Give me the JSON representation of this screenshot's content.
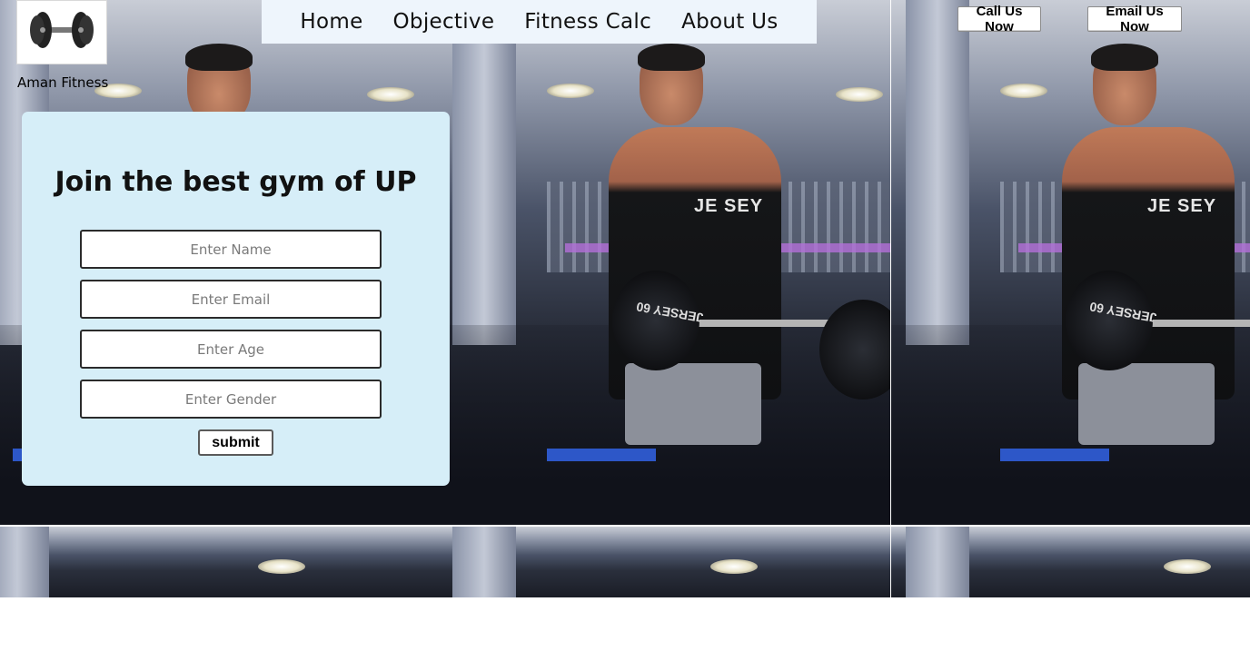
{
  "brand": {
    "name": "Aman Fitness",
    "logo_icon": "dumbbell-icon"
  },
  "nav": {
    "items": [
      {
        "label": "Home"
      },
      {
        "label": "Objective"
      },
      {
        "label": "Fitness Calc"
      },
      {
        "label": "About Us"
      }
    ]
  },
  "contact": {
    "call_label": "Call Us Now",
    "email_label": "Email Us Now"
  },
  "join_form": {
    "title": "Join the best gym of UP",
    "fields": [
      {
        "placeholder": "Enter Name",
        "value": ""
      },
      {
        "placeholder": "Enter Email",
        "value": ""
      },
      {
        "placeholder": "Enter Age",
        "value": ""
      },
      {
        "placeholder": "Enter Gender",
        "value": ""
      }
    ],
    "submit_label": "submit"
  },
  "colors": {
    "nav_bg": "#eef5fc",
    "card_bg": "#d6eef8",
    "page_bg": "#ffffff"
  }
}
